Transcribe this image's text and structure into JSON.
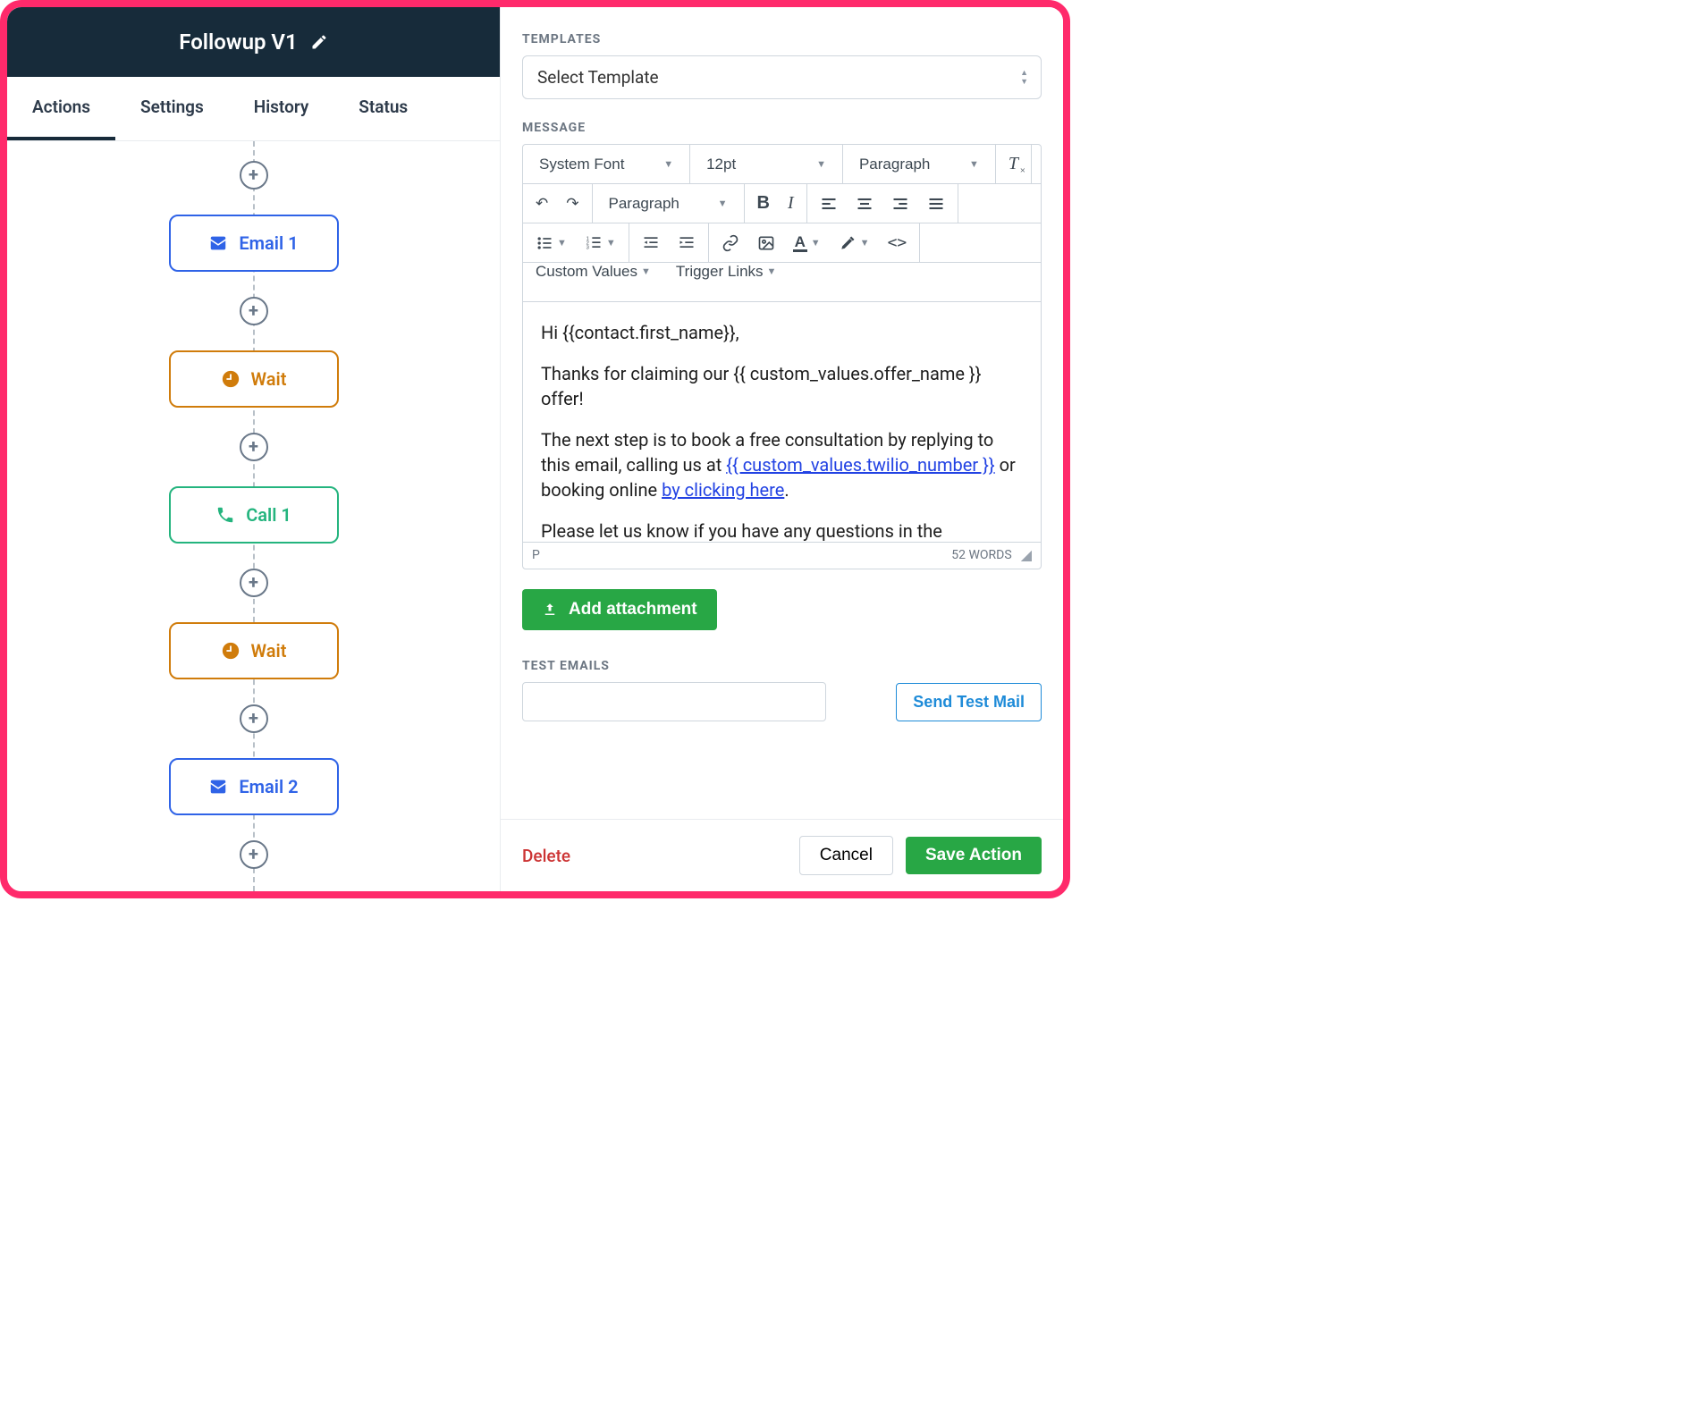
{
  "header": {
    "title": "Followup V1"
  },
  "tabs": [
    "Actions",
    "Settings",
    "History",
    "Status"
  ],
  "active_tab_index": 0,
  "flow_nodes": [
    {
      "type": "email",
      "label": "Email 1"
    },
    {
      "type": "wait",
      "label": "Wait"
    },
    {
      "type": "call",
      "label": "Call 1"
    },
    {
      "type": "wait",
      "label": "Wait"
    },
    {
      "type": "email",
      "label": "Email 2"
    }
  ],
  "right": {
    "templates_label": "TEMPLATES",
    "template_select": "Select Template",
    "message_label": "MESSAGE",
    "toolbar": {
      "font_family": "System Font",
      "font_size": "12pt",
      "block_format_top": "Paragraph",
      "block_format": "Paragraph",
      "custom_values": "Custom Values",
      "trigger_links": "Trigger Links"
    },
    "body": {
      "p1": "Hi {{contact.first_name}},",
      "p2a": "Thanks for claiming our {{ custom_values.offer_name }} offer!",
      "p3a": "The next step is to book a free consultation by replying to this email, calling us at ",
      "p3_link1": "{{ custom_values.twilio_number }}",
      "p3b": " or booking online ",
      "p3_link2": "by clicking here",
      "p3c": ".",
      "p4": "Please let us know if you have any questions in the"
    },
    "status_path": "P",
    "word_count": "52 WORDS",
    "add_attachment": "Add attachment",
    "test_emails_label": "TEST EMAILS",
    "send_test": "Send Test Mail",
    "delete": "Delete",
    "cancel": "Cancel",
    "save": "Save Action"
  }
}
